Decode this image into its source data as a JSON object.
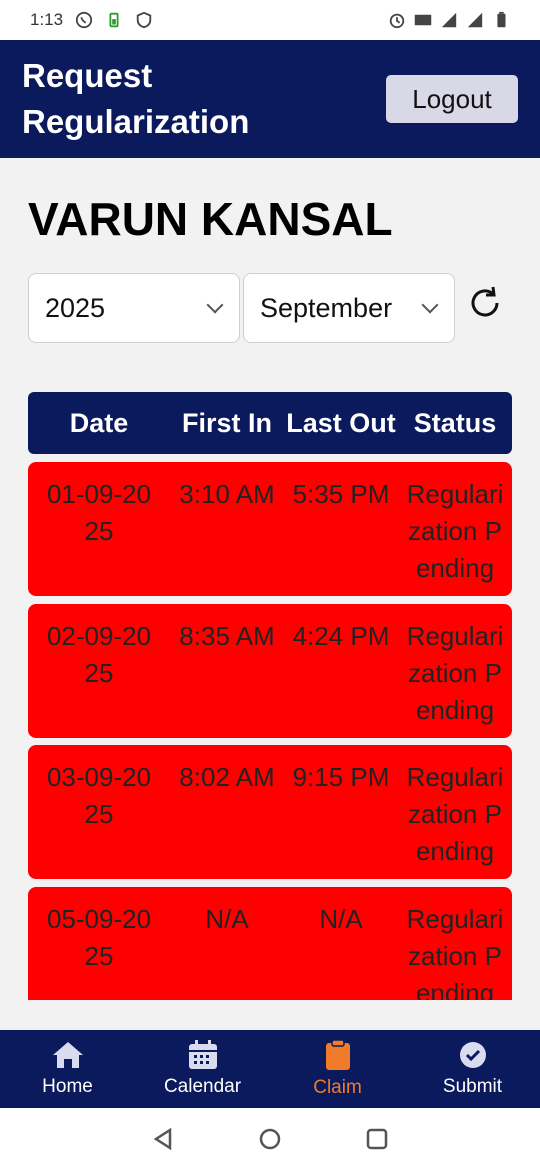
{
  "status_bar": {
    "time": "1:13",
    "left_icons": [
      "whatsapp-icon",
      "battery-saver-icon",
      "shield-icon"
    ],
    "right_icons": [
      "alarm-icon",
      "volte-icon",
      "4g-signal-icon",
      "signal-icon",
      "battery-icon"
    ]
  },
  "header": {
    "title": "Request Regularization",
    "logout_label": "Logout"
  },
  "employee": {
    "name": "VARUN KANSAL"
  },
  "filters": {
    "year": "2025",
    "month": "September"
  },
  "table": {
    "columns": [
      "Date",
      "First In",
      "Last Out",
      "Status"
    ],
    "rows": [
      {
        "date": "01-09-2025",
        "first_in": "3:10 AM",
        "last_out": "5:35 PM",
        "status": "Regularization Pending"
      },
      {
        "date": "02-09-2025",
        "first_in": "8:35 AM",
        "last_out": "4:24 PM",
        "status": "Regularization Pending"
      },
      {
        "date": "03-09-2025",
        "first_in": "8:02 AM",
        "last_out": "9:15 PM",
        "status": "Regularization Pending"
      },
      {
        "date": "05-09-2025",
        "first_in": "N/A",
        "last_out": "N/A",
        "status": "Regularization Pending"
      }
    ]
  },
  "bottom_nav": [
    {
      "label": "Home",
      "icon": "home-icon",
      "active": false
    },
    {
      "label": "Calendar",
      "icon": "calendar-icon",
      "active": false
    },
    {
      "label": "Claim",
      "icon": "clipboard-icon",
      "active": true
    },
    {
      "label": "Submit",
      "icon": "check-circle-icon",
      "active": false
    }
  ],
  "colors": {
    "primary": "#0a1a5c",
    "row_pending": "#ff0000",
    "active_nav": "#f07b2a"
  }
}
